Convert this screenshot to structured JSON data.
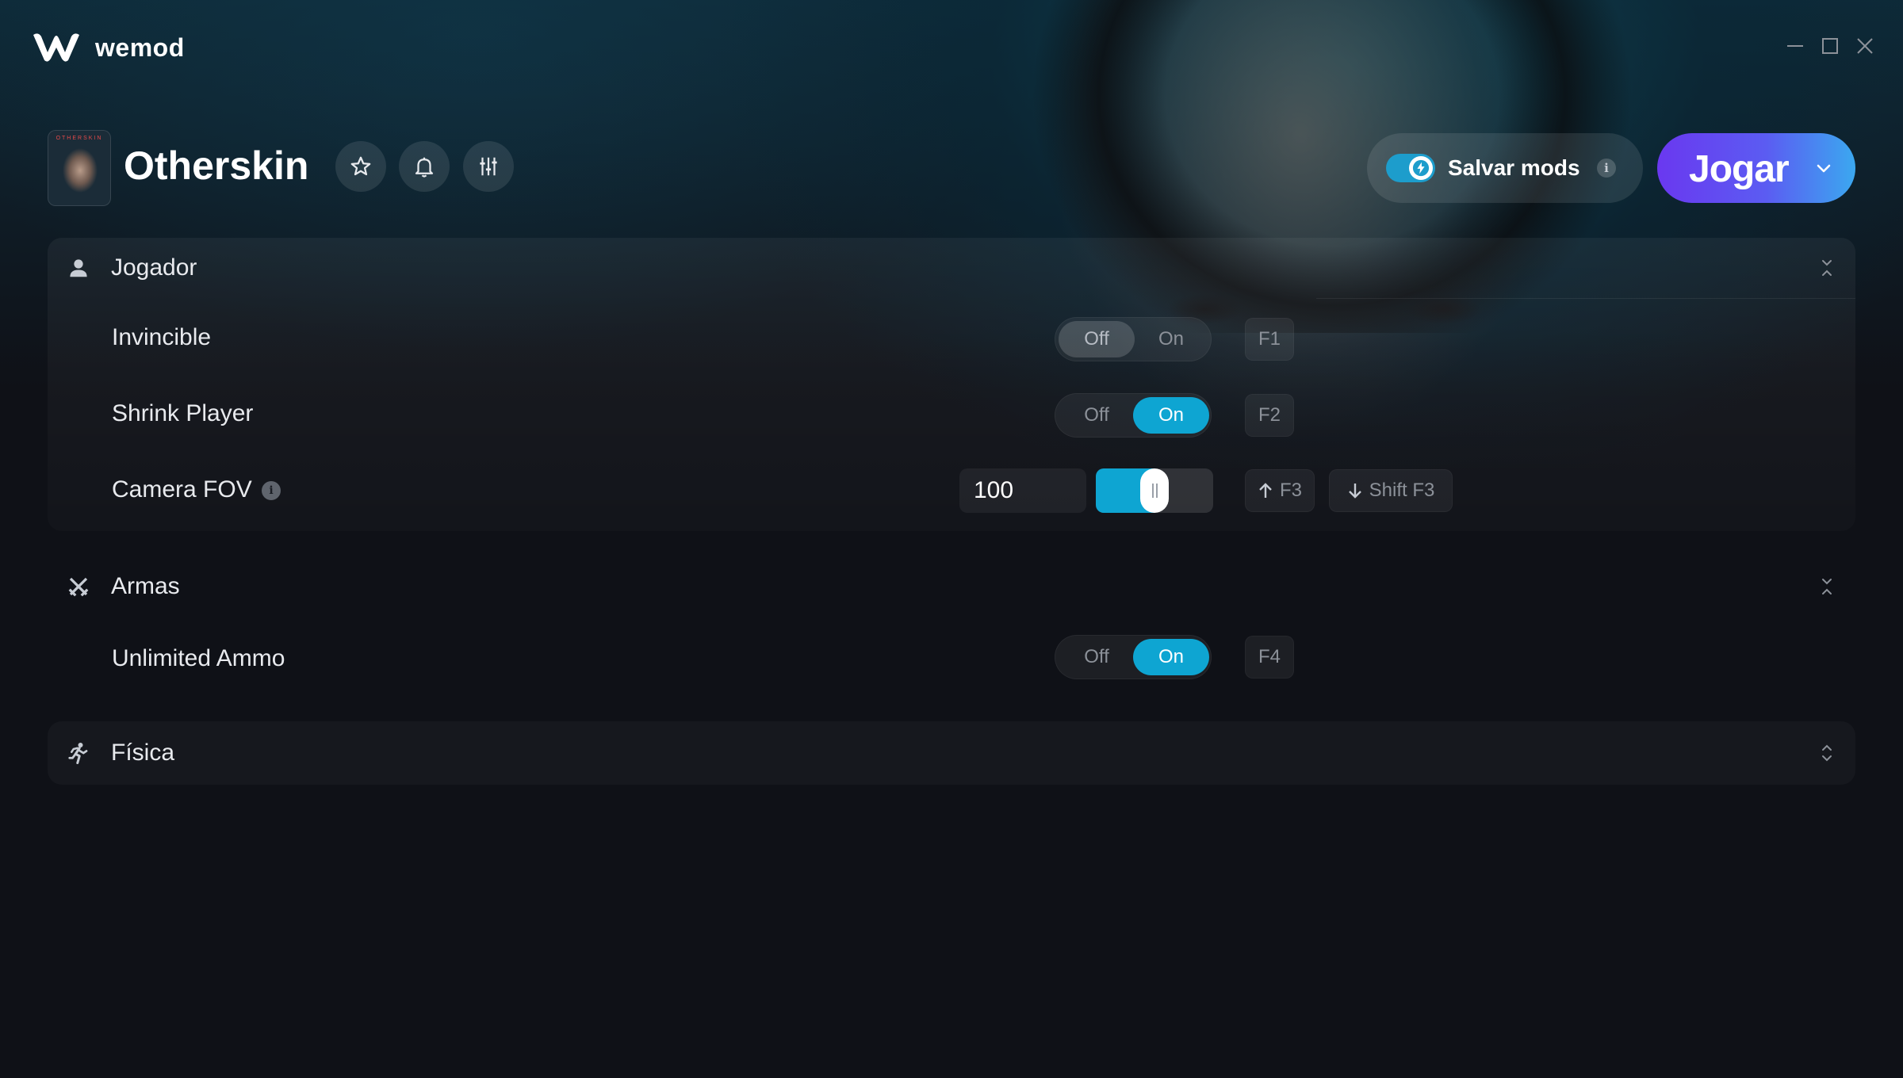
{
  "app": {
    "brand": "wemod"
  },
  "game": {
    "title": "Otherskin",
    "thumb_text": "OTHERSKIN"
  },
  "header": {
    "save_mods_label": "Salvar mods",
    "save_mods_enabled": true,
    "info_glyph": "i",
    "play_label": "Jogar"
  },
  "categories": [
    {
      "label": "Jogador",
      "icon": "person-icon",
      "expanded": true,
      "mods": [
        {
          "label": "Invincible",
          "type": "toggle",
          "off_label": "Off",
          "on_label": "On",
          "state": "Off",
          "hotkey": "F1"
        },
        {
          "label": "Shrink Player",
          "type": "toggle",
          "off_label": "Off",
          "on_label": "On",
          "state": "On",
          "hotkey": "F2"
        },
        {
          "label": "Camera FOV",
          "type": "slider",
          "value": "100",
          "slider_fraction": 0.5,
          "hotkey_up": "F3",
          "hotkey_down": "Shift F3"
        }
      ]
    },
    {
      "label": "Armas",
      "icon": "crossed-swords-icon",
      "expanded": true,
      "mods": [
        {
          "label": "Unlimited Ammo",
          "type": "toggle",
          "off_label": "Off",
          "on_label": "On",
          "state": "On",
          "hotkey": "F4"
        }
      ]
    },
    {
      "label": "Física",
      "icon": "running-icon",
      "expanded": false,
      "mods": []
    }
  ],
  "colors": {
    "accent": "#0ea5d2",
    "play_gradient_start": "#6a38f0",
    "play_gradient_end": "#3ba8f0",
    "background": "#0f1117"
  }
}
